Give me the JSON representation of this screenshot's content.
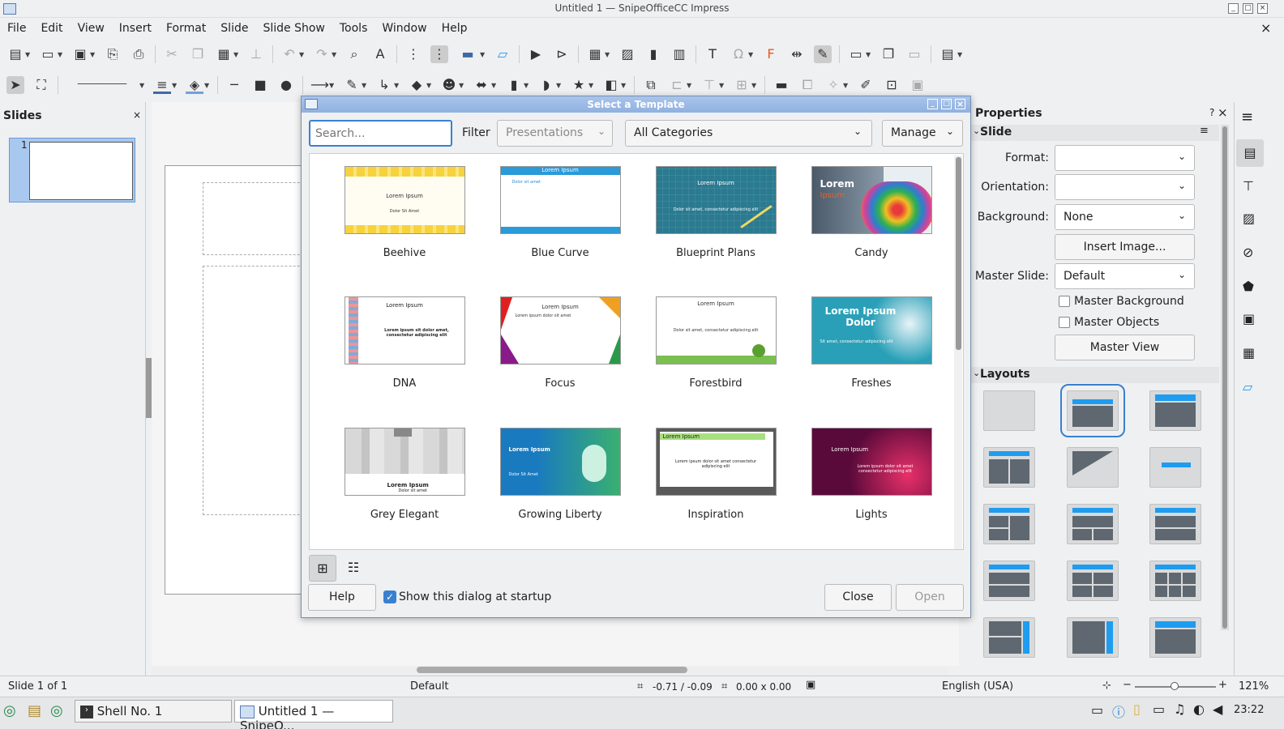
{
  "window": {
    "title": "Untitled 1 — SnipeOfficeCC Impress"
  },
  "menu": [
    "File",
    "Edit",
    "View",
    "Insert",
    "Format",
    "Slide",
    "Slide Show",
    "Tools",
    "Window",
    "Help"
  ],
  "slides_pane": {
    "title": "Slides",
    "close": "×",
    "slide_number": "1"
  },
  "dialog": {
    "title": "Select a Template",
    "search_placeholder": "Search...",
    "filter_label": "Filter",
    "filter_value": "Presentations",
    "category_value": "All Categories",
    "manage_label": "Manage",
    "templates": [
      {
        "name": "Beehive",
        "text1": "Lorem Ipsum",
        "text2": "Dolor Sit Amet"
      },
      {
        "name": "Blue Curve",
        "text1": "Lorem Ipsum",
        "text2": "Dolor sit amet"
      },
      {
        "name": "Blueprint Plans",
        "text1": "Lorem Ipsum",
        "text2": "Dolor sit amet, consectetur adipiscing elit"
      },
      {
        "name": "Candy",
        "text1": "Lorem",
        "text2": "Ipsum"
      },
      {
        "name": "DNA",
        "text1": "Lorem Ipsum",
        "text2": "Lorem ipsum sit dolor amet, consectetur adipiscing elit"
      },
      {
        "name": "Focus",
        "text1": "Lorem Ipsum",
        "text2": "Lorem ipsum dolor sit amet"
      },
      {
        "name": "Forestbird",
        "text1": "Lorem Ipsum",
        "text2": "Dolor sit amet, consectetur adipiscing elit"
      },
      {
        "name": "Freshes",
        "text1": "Lorem Ipsum Dolor",
        "text2": "Sit amet, consectetur adipiscing elit"
      },
      {
        "name": "Grey Elegant",
        "text1": "Lorem Ipsum",
        "text2": "Dolor sit amet"
      },
      {
        "name": "Growing Liberty",
        "text1": "Lorem Ipsum",
        "text2": "Dolor Sit Amet"
      },
      {
        "name": "Inspiration",
        "text1": "Lorem Ipsum",
        "text2": "Lorem ipsum dolor sit amet consectetur adipiscing elit"
      },
      {
        "name": "Lights",
        "text1": "Lorem Ipsum",
        "text2": "Lorem ipsum dolor sit amet consectetur adipiscing elit"
      }
    ],
    "help_label": "Help",
    "startup_label": "Show this dialog at startup",
    "close_label": "Close",
    "open_label": "Open"
  },
  "properties": {
    "title": "Properties",
    "slide_section": "Slide",
    "format_label": "Format:",
    "format_value": "",
    "orientation_label": "Orientation:",
    "orientation_value": "",
    "background_label": "Background:",
    "background_value": "None",
    "insert_image_label": "Insert Image...",
    "master_slide_label": "Master Slide:",
    "master_slide_value": "Default",
    "master_background_label": "Master Background",
    "master_objects_label": "Master Objects",
    "master_view_label": "Master View",
    "layouts_section": "Layouts"
  },
  "status": {
    "slide": "Slide 1 of 1",
    "master": "Default",
    "position": "-0.71 / -0.09",
    "size": "0.00 x 0.00",
    "language": "English (USA)",
    "zoom": "121%"
  },
  "taskbar": {
    "shell": "Shell No. 1",
    "impress": "Untitled 1 — SnipeO...",
    "clock": "23:22"
  }
}
